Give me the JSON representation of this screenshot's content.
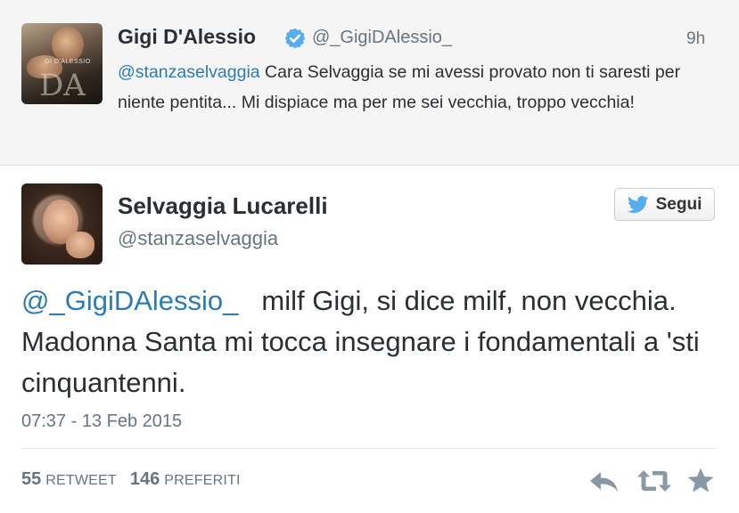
{
  "parent_tweet": {
    "author_name": "Gigi D'Alessio",
    "author_handle": "@_GigiDAlessio_",
    "time_ago": "9h",
    "avatar_logo_text": "DA",
    "avatar_caption": "GI D'ALESSIO",
    "mention": "@stanzaselvaggia",
    "text": " Cara Selvaggia se mi avessi provato non ti saresti per niente pentita... Mi dispiace ma per me sei vecchia, troppo vecchia!"
  },
  "tweet": {
    "author_name": "Selvaggia Lucarelli",
    "author_handle": "@stanzaselvaggia",
    "follow_label": "Segui",
    "mention": "@_GigiDAlessio_",
    "text": "milf Gigi, si dice milf, non vecchia. Madonna Santa mi tocca insegnare i fondamentali a 'sti cinquantenni.",
    "timestamp": "07:37 - 13 Feb 2015",
    "retweet_count": "55",
    "retweet_label": "RETWEET",
    "favorite_count": "146",
    "favorite_label": "PREFERITI"
  },
  "icons": {
    "verified": "verified-badge-icon",
    "follow": "twitter-bird-icon",
    "reply": "reply-icon",
    "retweet": "retweet-icon",
    "favorite": "star-icon"
  },
  "colors": {
    "link": "#2b7bb9",
    "verified": "#55acee",
    "bird": "#55acee",
    "muted": "#66757f",
    "text": "#292f33",
    "parent_bg": "#f5f5f5"
  }
}
